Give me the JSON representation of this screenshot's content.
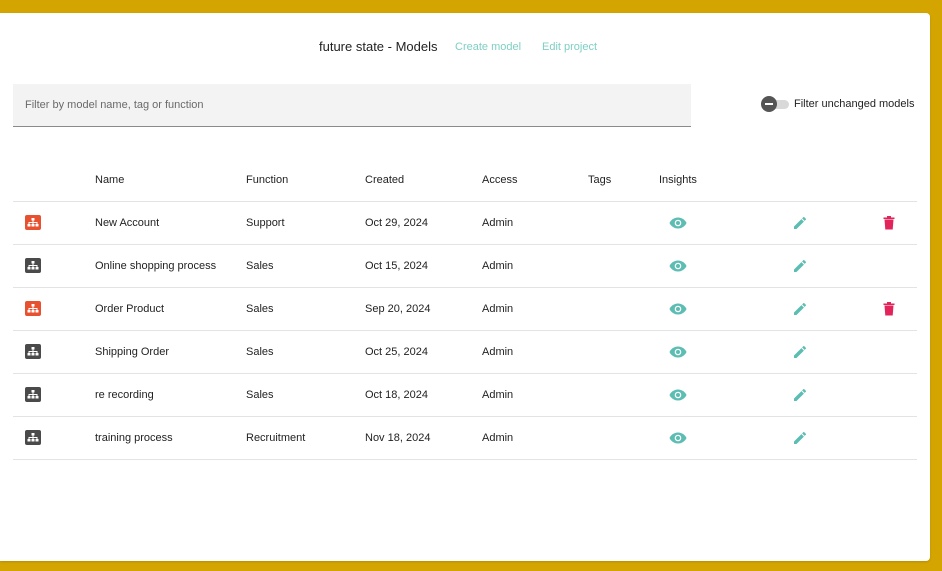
{
  "header": {
    "title": "future state - Models",
    "create_model": "Create model",
    "edit_project": "Edit project"
  },
  "search": {
    "placeholder": "Filter by model name, tag or function",
    "value": ""
  },
  "filter_toggle": {
    "label": "Filter unchanged models",
    "checked": false
  },
  "table": {
    "columns": [
      "",
      "Name",
      "Function",
      "Created",
      "Access",
      "Tags",
      "Insights",
      "",
      ""
    ],
    "rows": [
      {
        "icon": "org-chart-icon",
        "icon_color": "#e8512f",
        "name": "New Account",
        "function": "Support",
        "created": "Oct 29, 2024",
        "access": "Admin",
        "tags": "",
        "deletable": true
      },
      {
        "icon": "org-chart-icon",
        "icon_color": "#4a4a4a",
        "name": "Online shopping process",
        "function": "Sales",
        "created": "Oct 15, 2024",
        "access": "Admin",
        "tags": "",
        "deletable": false
      },
      {
        "icon": "org-chart-icon",
        "icon_color": "#e8512f",
        "name": "Order Product",
        "function": "Sales",
        "created": "Sep 20, 2024",
        "access": "Admin",
        "tags": "",
        "deletable": true
      },
      {
        "icon": "org-chart-icon",
        "icon_color": "#4a4a4a",
        "name": "Shipping Order",
        "function": "Sales",
        "created": "Oct 25, 2024",
        "access": "Admin",
        "tags": "",
        "deletable": false
      },
      {
        "icon": "org-chart-icon",
        "icon_color": "#4a4a4a",
        "name": "re recording",
        "function": "Sales",
        "created": "Oct 18, 2024",
        "access": "Admin",
        "tags": "",
        "deletable": false
      },
      {
        "icon": "org-chart-icon",
        "icon_color": "#4a4a4a",
        "name": "training process",
        "function": "Recruitment",
        "created": "Nov 18, 2024",
        "access": "Admin",
        "tags": "",
        "deletable": false
      }
    ]
  },
  "colors": {
    "frame": "#d4a500",
    "accent": "#7ecfc4",
    "insights_icon": "#5cbdb3",
    "edit_icon": "#5cbdb3",
    "delete_icon": "#e2245a"
  }
}
